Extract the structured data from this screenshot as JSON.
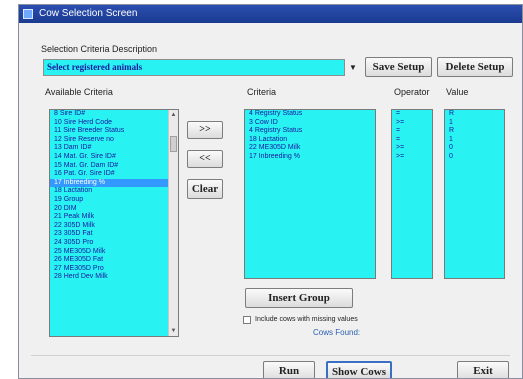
{
  "window": {
    "title": "Cow Selection Screen"
  },
  "selection": {
    "description_label": "Selection Criteria Description",
    "combo_value": "Select registered animals",
    "save_setup": "Save Setup",
    "delete_setup": "Delete Setup"
  },
  "available": {
    "label": "Available Criteria",
    "items": [
      "8 Sire ID#",
      "10 Sire Herd Code",
      "11 Sire Breeder Status",
      "12 Sire Reserve no",
      "13 Dam ID#",
      "14 Mat. Gr. Sire ID#",
      "15 Mat. Gr. Dam ID#",
      "16 Pat. Gr. Sire ID#",
      "17 Inbreeding %",
      "18 Lactation",
      "19 Group",
      "20 DIM",
      "21 Peak Milk",
      "22 305D Milk",
      "23 305D Fat",
      "24 305D Pro",
      "25 ME305D Milk",
      "26 ME305D Fat",
      "27 ME305D Pro",
      "28 Herd Dev Milk"
    ],
    "selected_index": 8
  },
  "transfer": {
    "add": ">>",
    "remove": "<<",
    "clear": "Clear"
  },
  "criteria": {
    "label": "Criteria",
    "items": [
      "4 Registry Status",
      "3 Cow ID",
      "4 Registry Status",
      "18 Lactation",
      "22 ME305D Milk",
      "17 Inbreeding %"
    ]
  },
  "operator": {
    "label": "Operator",
    "items": [
      "=",
      ">=",
      "=",
      "=",
      ">=",
      ">="
    ]
  },
  "value": {
    "label": "Value",
    "items": [
      "R",
      "1",
      "R",
      "1",
      "0",
      "0"
    ]
  },
  "insert_group": "Insert Group",
  "include_missing_label": "Include cows with missing values",
  "cows_found_label": "Cows Found:",
  "footer": {
    "run": "Run",
    "show_cows": "Show Cows",
    "exit": "Exit"
  }
}
